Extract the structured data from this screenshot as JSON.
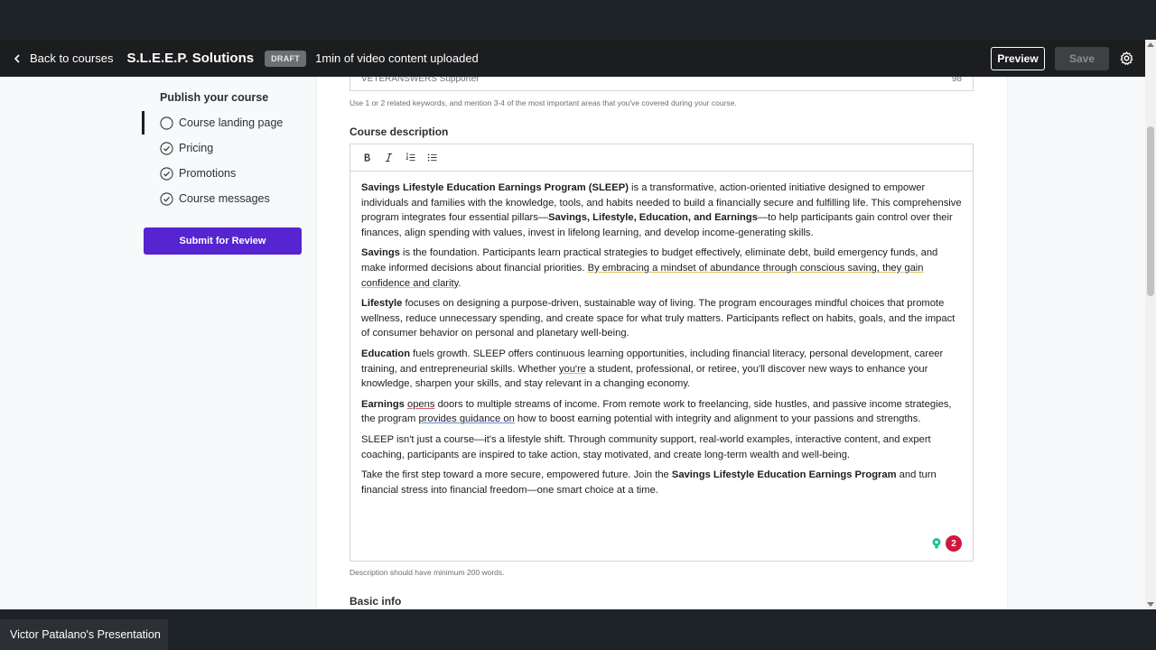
{
  "header": {
    "back_label": "Back to courses",
    "course_title": "S.L.E.E.P. Solutions",
    "status_badge": "DRAFT",
    "upload_status": "1min of video content uploaded",
    "preview_label": "Preview",
    "save_label": "Save"
  },
  "sidebar": {
    "heading": "Publish your course",
    "items": [
      {
        "label": "Course landing page"
      },
      {
        "label": "Pricing"
      },
      {
        "label": "Promotions"
      },
      {
        "label": "Course messages"
      }
    ],
    "submit_label": "Submit for Review"
  },
  "main": {
    "keyword_value": "VETERANSWERS Supporter",
    "keyword_count": "98",
    "keyword_helper": "Use 1 or 2 related keywords, and mention 3-4 of the most important areas that you've covered during your course.",
    "description_label": "Course description",
    "toolbar": [
      "bold",
      "italic",
      "numbered-list",
      "bulleted-list"
    ],
    "description": {
      "p1_b1": "Savings Lifestyle Education Earnings Program (SLEEP)",
      "p1_t1": " is a transformative, action-oriented initiative designed to empower individuals and families with the knowledge, tools, and habits needed to build a financially secure and fulfilling life. This comprehensive program integrates four essential pillars—",
      "p1_b2": "Savings, Lifestyle, Education, and Earnings",
      "p1_t2": "—to help participants gain control over their finances, align spending with values, invest in lifelong learning, and develop income-generating skills.",
      "p2_b": "Savings",
      "p2_t1": " is the foundation. Participants learn practical strategies to budget effectively, eliminate debt, build emergency funds, and make informed decisions about financial priorities. ",
      "p2_u": "By embracing a mindset of abundance through conscious saving, they gain confidence and clarity",
      "p2_t2": ".",
      "p3_b": "Lifestyle",
      "p3_t": " focuses on designing a purpose-driven, sustainable way of living. The program encourages mindful choices that promote wellness, reduce unnecessary spending, and create space for what truly matters. Participants reflect on habits, goals, and the impact of consumer behavior on personal and planetary well-being.",
      "p4_b": "Education",
      "p4_t1": " fuels growth. SLEEP offers continuous learning opportunities, including financial literacy, personal development, career training, and entrepreneurial skills. Whether ",
      "p4_u": "you're",
      "p4_t2": " a student, professional, or retiree, you'll discover new ways to enhance your knowledge, sharpen your skills, and stay relevant in a changing economy.",
      "p5_b": "Earnings",
      "p5_t0": " ",
      "p5_u1": "opens",
      "p5_t1": " doors to multiple streams of income. From remote work to freelancing, side hustles, and passive income strategies, the program ",
      "p5_u2": "provides guidance on",
      "p5_t2": " how to boost earning potential with integrity and alignment to your passions and strengths.",
      "p6": "SLEEP isn't just a course—it's a lifestyle shift. Through community support, real-world examples, interactive content, and expert coaching, participants are inspired to take action, stay motivated, and create long-term wealth and well-being.",
      "p7_t1": "Take the first step toward a more secure, empowered future. Join the ",
      "p7_b": "Savings Lifestyle Education Earnings Program",
      "p7_t2": " and turn financial stress into financial freedom—one smart choice at a time."
    },
    "grammar_count": "2",
    "description_helper": "Description should have minimum 200 words.",
    "basic_info_label": "Basic info"
  },
  "presenter_label": "Victor Patalano's Presentation",
  "colors": {
    "accent": "#5624d0",
    "header_bg": "#1c1d1f",
    "grammar_badge": "#d1183c"
  }
}
